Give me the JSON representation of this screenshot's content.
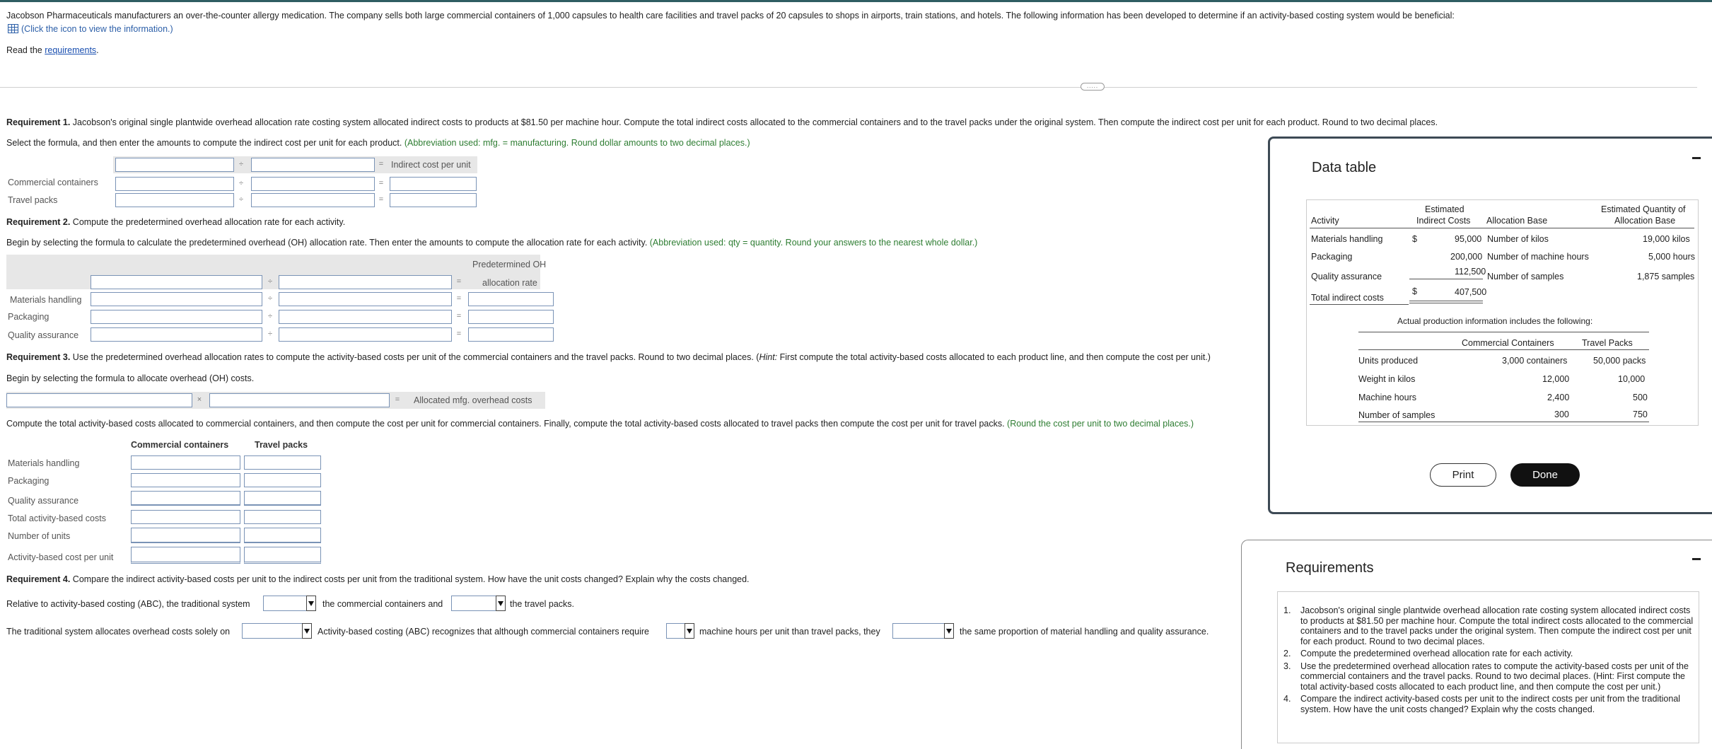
{
  "intro": {
    "text": "Jacobson Pharmaceuticals manufacturers an over-the-counter allergy medication. The company sells both large commercial containers of 1,000 capsules to health care facilities and travel packs of 20 capsules to shops in airports, train stations, and hotels. The following information has been developed to determine if an activity-based costing system would be beneficial:",
    "icon_link": "(Click the icon to view the information.)",
    "read_prefix": "Read the ",
    "requirements_link": "requirements",
    "read_suffix": "."
  },
  "req1": {
    "bold": "Requirement 1.",
    "text": " Jacobson's original single plantwide overhead allocation rate costing system allocated indirect costs to products at $81.50 per machine hour. Compute the total indirect costs allocated to the commercial containers and to the travel packs under the original system. Then compute the indirect cost per unit for each product. Round to two decimal places.",
    "instr": "Select the formula, and then enter the amounts to compute the indirect cost per unit for each product.",
    "hint": " (Abbreviation used: mfg. = manufacturing. Round dollar amounts to two decimal places.)",
    "result_label": "Indirect cost per unit",
    "rows": [
      "Commercial containers",
      "Travel packs"
    ]
  },
  "req2": {
    "bold": "Requirement 2.",
    "text": " Compute the predetermined overhead allocation rate for each activity.",
    "instr": "Begin by selecting the formula to calculate the predetermined overhead (OH) allocation rate. Then enter the amounts to compute the allocation rate for each activity.",
    "hint": " (Abbreviation used: qty = quantity. Round your answers to the nearest whole dollar.)",
    "header_line1": "Predetermined OH",
    "header_line2": "allocation rate",
    "rows": [
      "Materials handling",
      "Packaging",
      "Quality assurance"
    ]
  },
  "req3": {
    "bold": "Requirement 3.",
    "text": " Use the predetermined overhead allocation rates to compute the activity-based costs per unit of the commercial containers and the travel packs. Round to two decimal places. (",
    "hint_italic": "Hint:",
    "text2": " First compute the total activity-based costs allocated to each product line, and then compute the cost per unit.)",
    "instr": "Begin by selecting the formula to allocate overhead (OH) costs.",
    "result_label": "Allocated mfg. overhead costs",
    "compute_text": "Compute the total activity-based costs allocated to commercial containers, and then compute the cost per unit for commercial containers. Finally, compute the total activity-based costs allocated to travel packs then compute the cost per unit for travel packs.",
    "compute_hint": " (Round the cost per unit to two decimal places.)",
    "col_headers": [
      "Commercial containers",
      "Travel packs"
    ],
    "rows": [
      "Materials handling",
      "Packaging",
      "Quality assurance",
      "Total activity-based costs",
      "Number of units",
      "Activity-based cost per unit"
    ]
  },
  "req4": {
    "bold": "Requirement 4.",
    "text": " Compare the indirect activity-based costs per unit to the indirect costs per unit from the traditional system. How have the unit costs changed? Explain why the costs changed.",
    "line1_a": "Relative to activity-based costing (ABC), the traditional system",
    "line1_b": "the commercial containers and",
    "line1_c": "the travel packs.",
    "line2_a": "The traditional system allocates overhead costs solely on",
    "line2_b": "Activity-based costing (ABC) recognizes that although commercial containers require",
    "line2_c": "machine hours per unit than travel packs, they",
    "line2_d": "the same proportion of material handling and quality assurance."
  },
  "data_table": {
    "title": "Data table",
    "headers": {
      "activity": "Activity",
      "est_costs_1": "Estimated",
      "est_costs_2": "Indirect Costs",
      "alloc_base": "Allocation Base",
      "est_qty_1": "Estimated Quantity of",
      "est_qty_2": "Allocation Base"
    },
    "rows": [
      {
        "activity": "Materials handling",
        "dollar": "$",
        "cost": "95,000",
        "base": "Number of kilos",
        "qty": "19,000 kilos"
      },
      {
        "activity": "Packaging",
        "dollar": "",
        "cost": "200,000",
        "base": "Number of machine hours",
        "qty": "5,000 hours"
      },
      {
        "activity": "Quality assurance",
        "dollar": "",
        "cost": "112,500",
        "base": "Number of samples",
        "qty": "1,875 samples"
      }
    ],
    "total": {
      "label": "Total indirect costs",
      "dollar": "$",
      "cost": "407,500"
    },
    "actual_title": "Actual production information includes the following:",
    "actual_headers": [
      "Commercial Containers",
      "Travel Packs"
    ],
    "actual_rows": [
      {
        "label": "Units produced",
        "cc": "3,000 containers",
        "tp": "50,000 packs"
      },
      {
        "label": "Weight in kilos",
        "cc": "12,000",
        "tp": "10,000"
      },
      {
        "label": "Machine hours",
        "cc": "2,400",
        "tp": "500"
      },
      {
        "label": "Number of samples",
        "cc": "300",
        "tp": "750"
      }
    ],
    "print_label": "Print",
    "done_label": "Done"
  },
  "requirements_panel": {
    "title": "Requirements",
    "items": [
      {
        "num": "1.",
        "text": "Jacobson's original single plantwide overhead allocation rate costing system allocated indirect costs to products at $81.50 per machine hour. Compute the total indirect costs allocated to the commercial containers and to the travel packs under the original system. Then compute the indirect cost per unit for each product. Round to two decimal places."
      },
      {
        "num": "2.",
        "text": "Compute the predetermined overhead allocation rate for each activity."
      },
      {
        "num": "3.",
        "text": "Use the predetermined overhead allocation rates to compute the activity-based costs per unit of the commercial containers and the travel packs. Round to two decimal places. (Hint: First compute the total activity-based costs allocated to each product line, and then compute the cost per unit.)"
      },
      {
        "num": "4.",
        "text": "Compare the indirect activity-based costs per unit to the indirect costs per unit from the traditional system. How have the unit costs changed? Explain why the costs changed."
      }
    ]
  },
  "ops": {
    "div": "÷",
    "eq": "=",
    "mul": "×",
    "drag_handle": "....."
  }
}
